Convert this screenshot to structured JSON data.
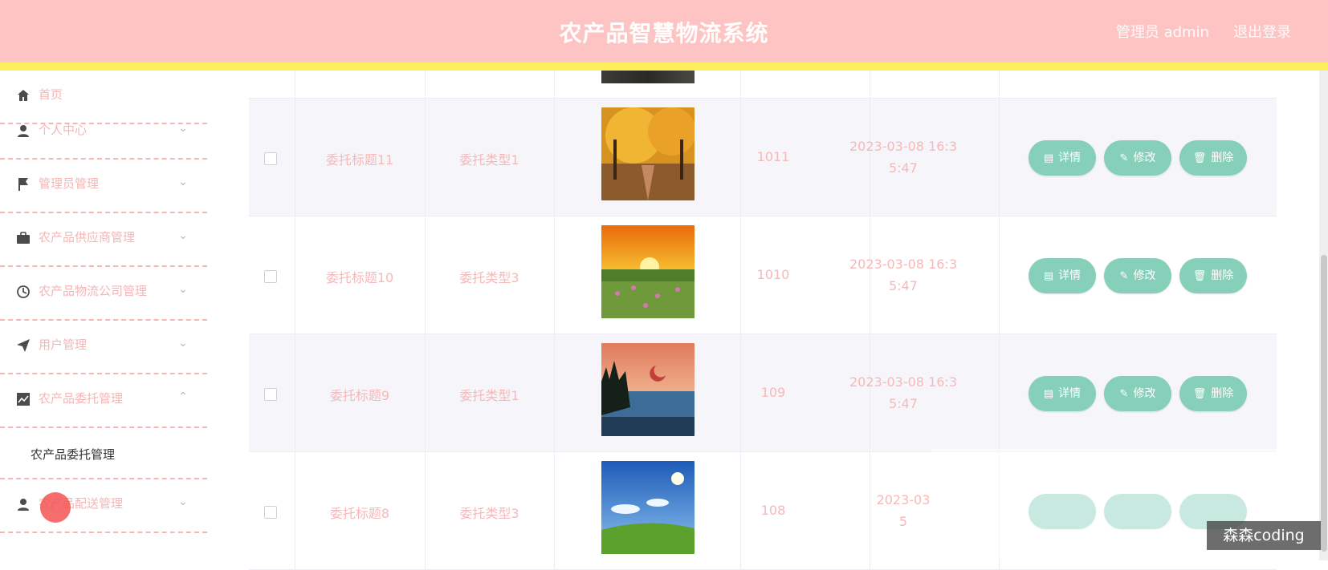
{
  "header": {
    "title": "农产品智慧物流系统",
    "admin_label": "管理员 admin",
    "logout_label": "退出登录",
    "colors": {
      "header_bg": "#fdc4c3",
      "accent_bar": "#fdef5c"
    }
  },
  "sidebar": {
    "items": [
      {
        "label": "首页",
        "icon": "home-icon"
      },
      {
        "label": "个人中心",
        "icon": "user-icon",
        "arrow": "⌄"
      },
      {
        "label": "管理员管理",
        "icon": "flag-icon",
        "arrow": "⌄"
      },
      {
        "label": "农产品供应商管理",
        "icon": "briefcase-icon",
        "arrow": "⌄"
      },
      {
        "label": "农产品物流公司管理",
        "icon": "clock-icon",
        "arrow": "⌄"
      },
      {
        "label": "用户管理",
        "icon": "send-icon",
        "arrow": "⌄"
      },
      {
        "label": "农产品委托管理",
        "icon": "chart-icon",
        "arrow": "⌃"
      },
      {
        "label": "农产品配送管理",
        "icon": "user-icon",
        "arrow": "⌄"
      }
    ],
    "submenu": [
      {
        "label": "农产品委托管理"
      }
    ]
  },
  "table": {
    "rows": [
      {
        "title": "委托标题11",
        "type": "委托类型1",
        "number": "1011",
        "date_line1": "2023-03-08 16:3",
        "date_line2": "5:47",
        "image": "autumn-trees"
      },
      {
        "title": "委托标题10",
        "type": "委托类型3",
        "number": "1010",
        "date_line1": "2023-03-08 16:3",
        "date_line2": "5:47",
        "image": "sunset-field"
      },
      {
        "title": "委托标题9",
        "type": "委托类型1",
        "number": "109",
        "date_line1": "2023-03-08 16:3",
        "date_line2": "5:47",
        "image": "lake-dusk"
      },
      {
        "title": "委托标题8",
        "type": "委托类型3",
        "number": "108",
        "date_line1": "2023-03",
        "date_line2": "5",
        "image": "blue-sky-meadow"
      }
    ],
    "actions": {
      "detail": "详情",
      "edit": "修改",
      "delete": "删除"
    }
  },
  "watermark": "森森coding"
}
